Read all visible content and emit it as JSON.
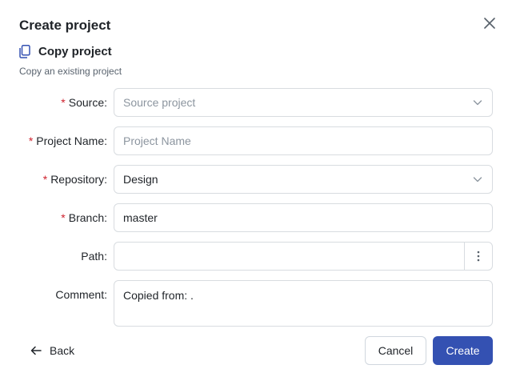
{
  "dialog": {
    "title": "Create project",
    "close_icon": "close-icon"
  },
  "subheader": {
    "icon": "copy-icon",
    "title": "Copy project",
    "description": "Copy an existing project"
  },
  "form": {
    "required_mark": "*",
    "source": {
      "label": "Source:",
      "placeholder": "Source project",
      "value": ""
    },
    "project_name": {
      "label": "Project Name:",
      "placeholder": "Project Name",
      "value": ""
    },
    "repository": {
      "label": "Repository:",
      "value": "Design"
    },
    "branch": {
      "label": "Branch:",
      "value": "master"
    },
    "path": {
      "label": "Path:",
      "value": "",
      "more_icon": "more-vertical-icon"
    },
    "comment": {
      "label": "Comment:",
      "value": "Copied from: ."
    }
  },
  "footer": {
    "back_label": "Back",
    "cancel_label": "Cancel",
    "create_label": "Create"
  },
  "colors": {
    "primary": "#3451b2",
    "required": "#cf222e",
    "border": "#d8dce0"
  }
}
